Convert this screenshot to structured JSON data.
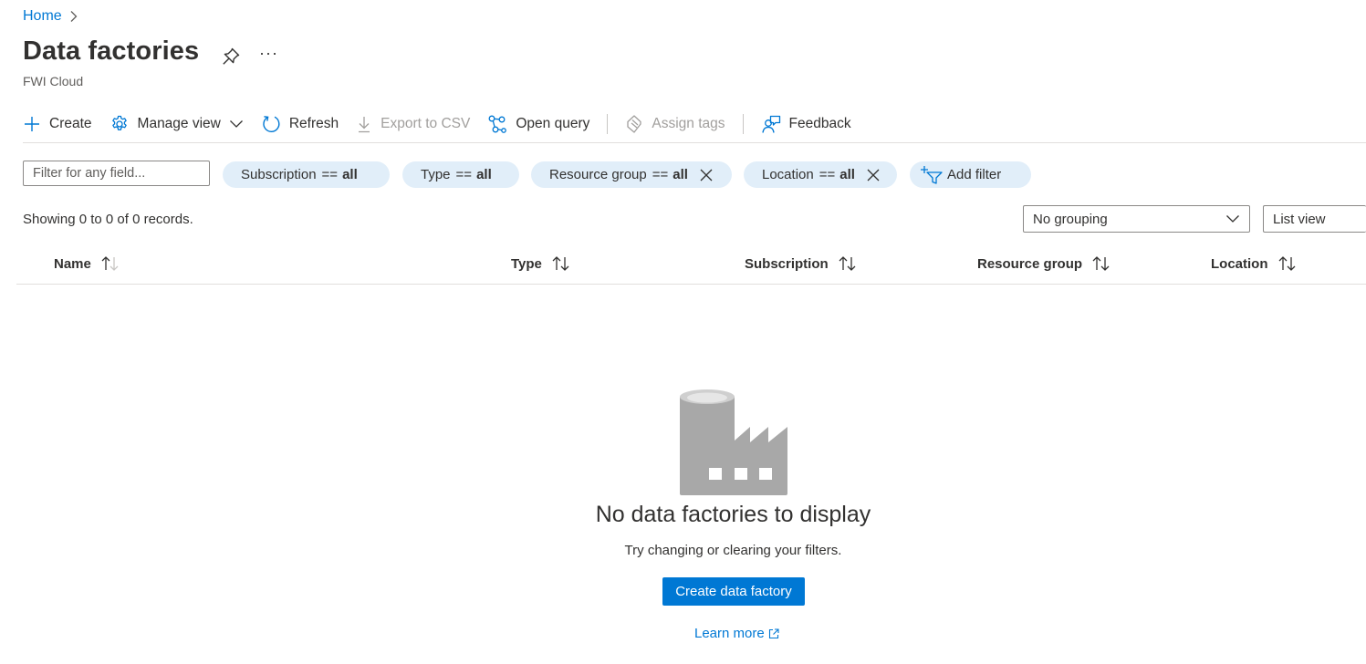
{
  "breadcrumb": {
    "home": "Home"
  },
  "header": {
    "title": "Data factories",
    "subtitle": "FWI Cloud",
    "more": "···"
  },
  "toolbar": {
    "create": "Create",
    "manage_view": "Manage view",
    "refresh": "Refresh",
    "export_csv": "Export to CSV",
    "open_query": "Open query",
    "assign_tags": "Assign tags",
    "feedback": "Feedback"
  },
  "filters": {
    "placeholder": "Filter for any field...",
    "operator": "==",
    "subscription": {
      "label": "Subscription",
      "value": "all"
    },
    "type": {
      "label": "Type",
      "value": "all"
    },
    "resource_group": {
      "label": "Resource group",
      "value": "all"
    },
    "location": {
      "label": "Location",
      "value": "all"
    },
    "add_filter": "Add filter"
  },
  "records_text": "Showing 0 to 0 of 0 records.",
  "grouping": {
    "selected": "No grouping"
  },
  "view": {
    "selected": "List view"
  },
  "table": {
    "columns": [
      "Name",
      "Type",
      "Subscription",
      "Resource group",
      "Location"
    ],
    "rows": []
  },
  "empty_state": {
    "title": "No data factories to display",
    "subtitle": "Try changing or clearing your filters.",
    "button": "Create data factory",
    "learn_more": "Learn more"
  },
  "colors": {
    "accent": "#0078d4",
    "pill_bg": "#e1eef9",
    "text": "#323130",
    "disabled": "#a19f9d"
  }
}
